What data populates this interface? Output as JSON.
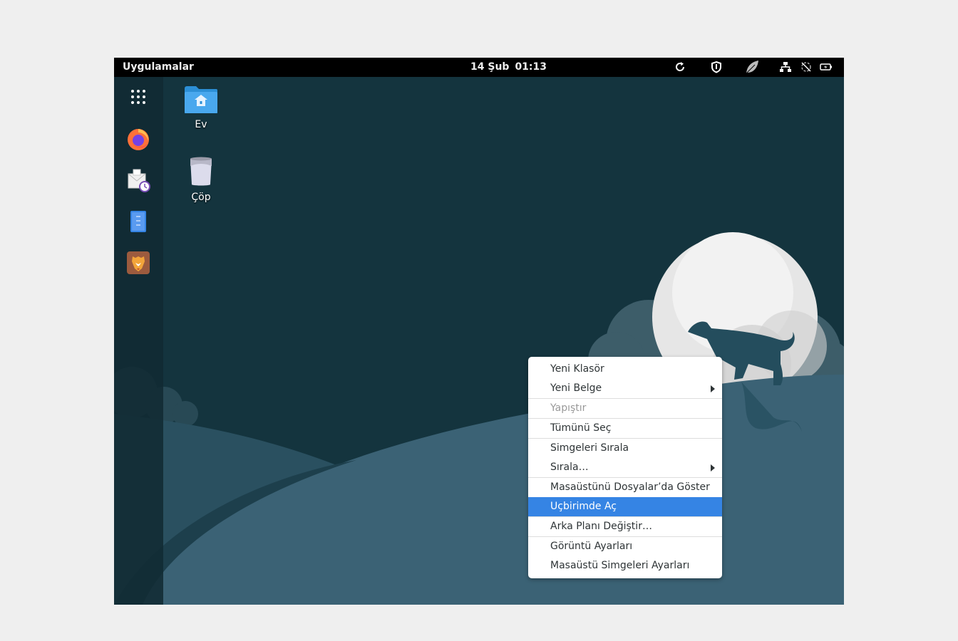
{
  "topbar": {
    "apps_label": "Uygulamalar",
    "date": "14 Şub",
    "time": "01:13",
    "tray_icons": [
      "refresh-icon",
      "shield-icon",
      "leaf-icon",
      "network-icon",
      "sync-disabled-icon",
      "battery-icon"
    ]
  },
  "dock": {
    "items": [
      "app-grid-icon",
      "firefox-icon",
      "mail-clock-icon",
      "text-editor-icon",
      "brave-lion-icon"
    ]
  },
  "desktop": {
    "icons": [
      {
        "label": "Ev",
        "icon": "home-folder-icon"
      },
      {
        "label": "Çöp",
        "icon": "trash-icon"
      }
    ]
  },
  "context_menu": {
    "items": [
      {
        "label": "Yeni Klasör"
      },
      {
        "label": "Yeni Belge",
        "submenu": true
      },
      {
        "label": "Yapıştır",
        "disabled": true
      },
      {
        "label": "Tümünü Seç"
      },
      {
        "label": "Simgeleri Sırala"
      },
      {
        "label": "Sırala…",
        "submenu": true
      },
      {
        "label": "Masaüstünü Dosyalar’da Göster"
      },
      {
        "label": "Uçbirimde Aç",
        "highlighted": true
      },
      {
        "label": "Arka Planı Değiştir…"
      },
      {
        "label": "Görüntü Ayarları"
      },
      {
        "label": "Masaüstü Simgeleri Ayarları"
      }
    ]
  },
  "colors": {
    "topbar": "#000000",
    "wallpaper_dark": "#15353f",
    "wallpaper_hill": "#3b6275",
    "highlight": "#3584e4"
  }
}
